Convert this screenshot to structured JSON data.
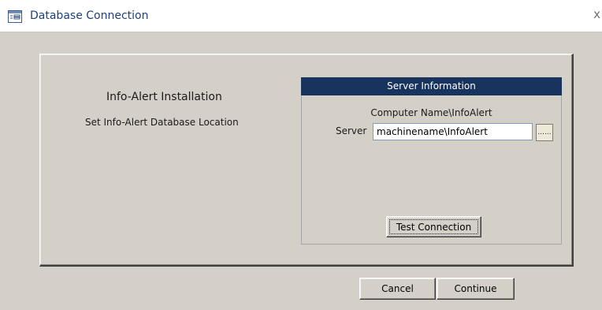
{
  "window": {
    "title": "Database Connection",
    "icon": "form-icon",
    "close_symbol": "x"
  },
  "install": {
    "title": "Info-Alert Installation",
    "subtitle": "Set Info-Alert Database Location"
  },
  "server_info": {
    "header": "Server Information",
    "hint": "Computer Name\\InfoAlert",
    "server_label": "Server",
    "server_value": "machinename\\InfoAlert",
    "browse_label": "......",
    "test_button_label": "Test Connection"
  },
  "footer": {
    "cancel_label": "Cancel",
    "continue_label": "Continue"
  },
  "colors": {
    "window_bg": "#d4d0c8",
    "header_bg": "#18335e",
    "title_text": "#1f3f7a"
  }
}
